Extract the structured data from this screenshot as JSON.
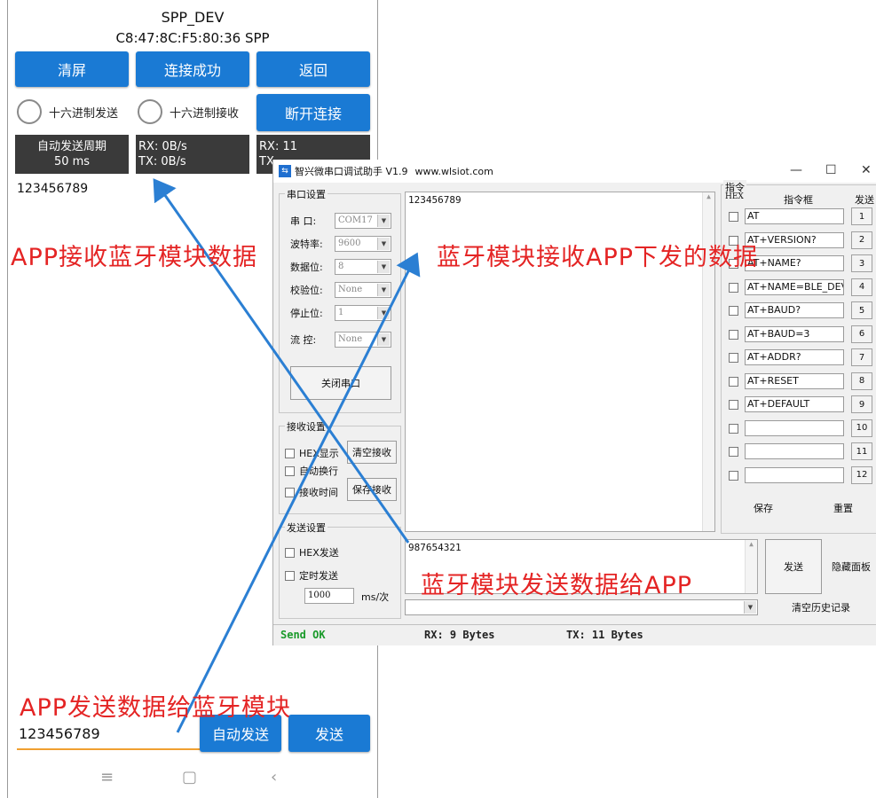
{
  "phone": {
    "device_name": "SPP_DEV",
    "address_line": "C8:47:8C:F5:80:36  SPP",
    "btn_clear": "清屏",
    "btn_connected": "连接成功",
    "btn_back": "返回",
    "radio_hex_send": "十六进制发送",
    "radio_hex_recv": "十六进制接收",
    "btn_disconnect": "断开连接",
    "auto_period_label": "自动发送周期",
    "auto_period_value": "50 ms",
    "rx_rate": "RX: 0B/s",
    "tx_rate": "TX: 0B/s",
    "rx_count": "RX: 11",
    "tx_count": "TX",
    "received_text": "123456789",
    "input_value": "123456789",
    "btn_auto_send": "自动发送",
    "btn_send": "发送",
    "nav_menu": "≡",
    "nav_home": "▢",
    "nav_back": "‹"
  },
  "serial_tool": {
    "title": "智兴微串口调试助手 V1.9",
    "url": "www.wlsiot.com",
    "win_min": "—",
    "win_max": "☐",
    "win_close": "✕",
    "serial_settings": {
      "group_title": "串口设置",
      "port_label": "串  口:",
      "port_value": "COM17",
      "baud_label": "波特率:",
      "baud_value": "9600",
      "databits_label": "数据位:",
      "databits_value": "8",
      "parity_label": "校验位:",
      "parity_value": "None",
      "stopbits_label": "停止位:",
      "stopbits_value": "1",
      "flow_label": "流  控:",
      "flow_value": "None",
      "close_port_button": "关闭串口"
    },
    "recv_settings": {
      "group_title": "接收设置",
      "hex_display": "HEX显示",
      "auto_newline": "自动换行",
      "recv_time": "接收时间",
      "clear_recv_button": "清空接收",
      "save_recv_button": "保存接收"
    },
    "send_settings": {
      "group_title": "发送设置",
      "hex_send": "HEX发送",
      "timed_send": "定时发送",
      "interval_value": "1000",
      "interval_unit": "ms/次"
    },
    "receive_area_text": "123456789",
    "send_area_text": "987654321",
    "send_button": "发送",
    "hide_panel_button": "隐藏面板",
    "clear_history_button": "清空历史记录",
    "commands": {
      "group_title": "指令",
      "hex_header": "HEX",
      "field_header": "指令框",
      "send_header": "发送",
      "items": [
        {
          "text": "AT",
          "num": "1"
        },
        {
          "text": "AT+VERSION?",
          "num": "2"
        },
        {
          "text": "AT+NAME?",
          "num": "3"
        },
        {
          "text": "AT+NAME=BLE_DEV",
          "num": "4"
        },
        {
          "text": "AT+BAUD?",
          "num": "5"
        },
        {
          "text": "AT+BAUD=3",
          "num": "6"
        },
        {
          "text": "AT+ADDR?",
          "num": "7"
        },
        {
          "text": "AT+RESET",
          "num": "8"
        },
        {
          "text": "AT+DEFAULT",
          "num": "9"
        },
        {
          "text": "",
          "num": "10"
        },
        {
          "text": "",
          "num": "11"
        },
        {
          "text": "",
          "num": "12"
        }
      ],
      "save_button": "保存",
      "reset_button": "重置"
    },
    "status": {
      "state": "Send OK",
      "rx": "RX: 9 Bytes",
      "tx": "TX: 11 Bytes"
    }
  },
  "annotations": {
    "app_receive": "APP接收蓝牙模块数据",
    "module_receive": "蓝牙模块接收APP下发的数据",
    "module_send": "蓝牙模块发送数据给APP",
    "app_send": "APP发送数据给蓝牙模块"
  },
  "colors": {
    "button_blue": "#1a7ad4",
    "annotation_red": "#e42424",
    "arrow_blue": "#2b7fd3",
    "status_green": "#1a9a2a",
    "input_underline": "#f0a030"
  }
}
